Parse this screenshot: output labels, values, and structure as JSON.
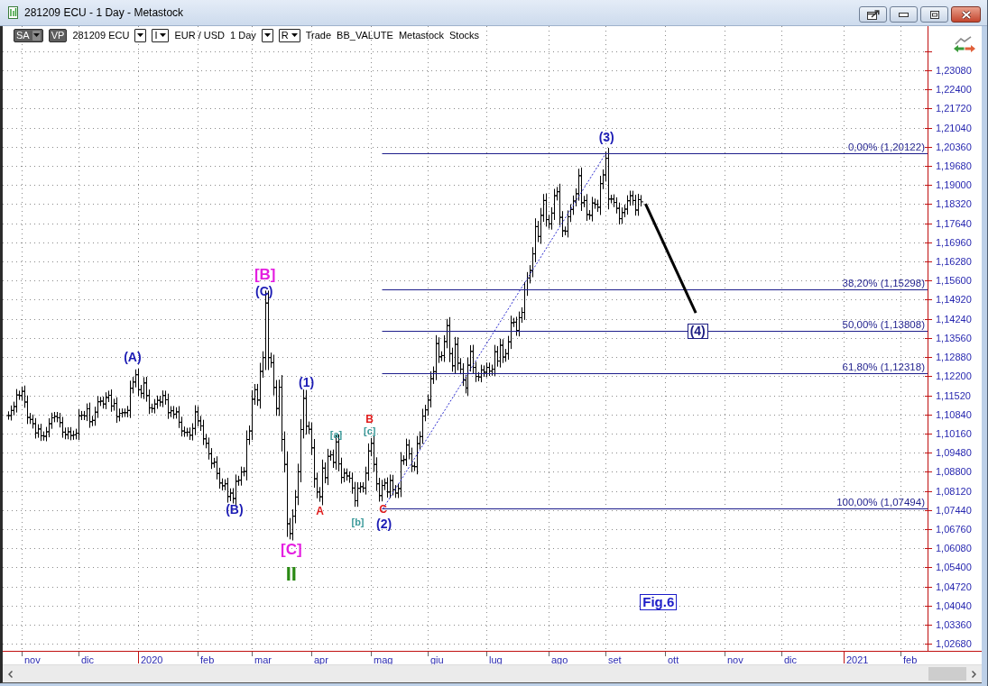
{
  "window": {
    "title": "281209 ECU - 1 Day - Metastock"
  },
  "toolbar": {
    "items": [
      {
        "kind": "dark-menu",
        "label": "SA"
      },
      {
        "kind": "dark-button",
        "label": "VP"
      },
      {
        "kind": "text",
        "label": "281209 ECU"
      },
      {
        "kind": "dropdown"
      },
      {
        "kind": "letter-dropdown",
        "label": "I"
      },
      {
        "kind": "text",
        "label": "EUR / USD"
      },
      {
        "kind": "text",
        "label": "1 Day"
      },
      {
        "kind": "dropdown"
      },
      {
        "kind": "letter-dropdown",
        "label": "R"
      },
      {
        "kind": "text",
        "label": "Trade"
      },
      {
        "kind": "text",
        "label": "BB_VALUTE"
      },
      {
        "kind": "text",
        "label": "Metastock"
      },
      {
        "kind": "text",
        "label": "Stocks"
      }
    ]
  },
  "chart": {
    "price_labels": [
      "1,23080",
      "1,22400",
      "1,21720",
      "1,21040",
      "1,20360",
      "1,19680",
      "1,19000",
      "1,18320",
      "1,17640",
      "1,16960",
      "1,16280",
      "1,15600",
      "1,14920",
      "1,14240",
      "1,13560",
      "1,12880",
      "1,12200",
      "1,11520",
      "1,10840",
      "1,10160",
      "1,09480",
      "1,08800",
      "1,08120",
      "1,07440",
      "1,06760",
      "1,06080",
      "1,05400",
      "1,04720",
      "1,04040",
      "1,03360",
      "1,02680"
    ],
    "month_labels": [
      "nov",
      "dic",
      "2020",
      "feb",
      "mar",
      "apr",
      "mag",
      "giu",
      "lug",
      "ago",
      "set",
      "ott",
      "nov",
      "dic",
      "2021",
      "feb"
    ],
    "wave_labels": [
      {
        "text": "(A)",
        "color": "#1c1cb4"
      },
      {
        "text": "(B)",
        "color": "#1c1cb4"
      },
      {
        "text": "[B]",
        "color": "#e41ee0"
      },
      {
        "text": "(C)",
        "color": "#1c1cb4"
      },
      {
        "text": "[C]",
        "color": "#e41ee0"
      },
      {
        "text": "II",
        "color": "#2a8a14"
      },
      {
        "text": "(1)",
        "color": "#1c1cb4"
      },
      {
        "text": "A",
        "color": "#e01b1b"
      },
      {
        "text": "[a]",
        "color": "#3a9999"
      },
      {
        "text": "[b]",
        "color": "#3a9999"
      },
      {
        "text": "B",
        "color": "#e01b1b"
      },
      {
        "text": "[c]",
        "color": "#3a9999"
      },
      {
        "text": "C",
        "color": "#e01b1b"
      },
      {
        "text": "(2)",
        "color": "#1c1cb4"
      },
      {
        "text": "(3)",
        "color": "#1c1cb4"
      }
    ],
    "fib_levels": [
      "0,00% (1,20122)",
      "38,20% (1,15298)",
      "50,00% (1,13808)",
      "61,80% (1,12318)",
      "100,00% (1,07494)"
    ],
    "target_label": "(4)",
    "caption": "Fig.6"
  }
}
